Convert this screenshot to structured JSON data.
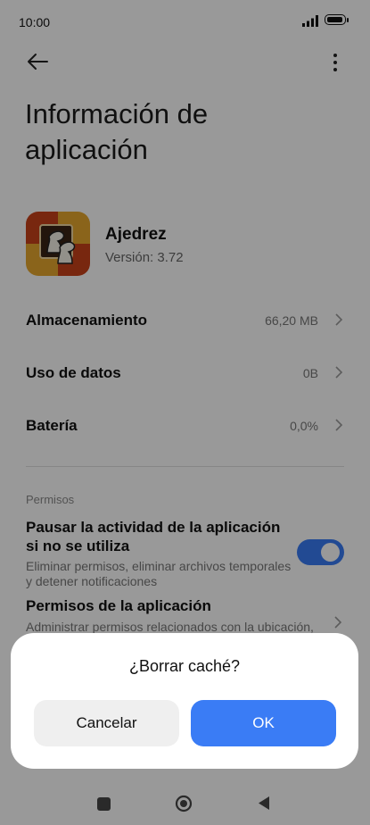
{
  "status_bar": {
    "time": "10:00"
  },
  "header": {
    "title": "Información de aplicación"
  },
  "app": {
    "name": "Ajedrez",
    "version": "Versión: 3.72"
  },
  "rows": [
    {
      "label": "Almacenamiento",
      "value": "66,20 MB"
    },
    {
      "label": "Uso de datos",
      "value": "0B"
    },
    {
      "label": "Batería",
      "value": "0,0%"
    }
  ],
  "permissions_section": {
    "header": "Permisos",
    "pause": {
      "title": "Pausar la actividad de la aplicación si no se utiliza",
      "subtitle": "Eliminar permisos, eliminar archivos temporales y detener notificaciones",
      "enabled": true
    },
    "app_permissions": {
      "title": "Permisos de la aplicación",
      "subtitle": "Administrar permisos relacionados con la ubicación,"
    }
  },
  "dialog": {
    "title": "¿Borrar caché?",
    "cancel_label": "Cancelar",
    "ok_label": "OK"
  },
  "colors": {
    "accent": "#3a7cf5",
    "scrim": "rgba(0,0,0,0.4)"
  },
  "icons": [
    "back-arrow-icon",
    "more-vert-icon",
    "chevron-right-icon",
    "signal-icon",
    "battery-icon",
    "nav-recents-icon",
    "nav-home-icon",
    "nav-back-icon"
  ]
}
